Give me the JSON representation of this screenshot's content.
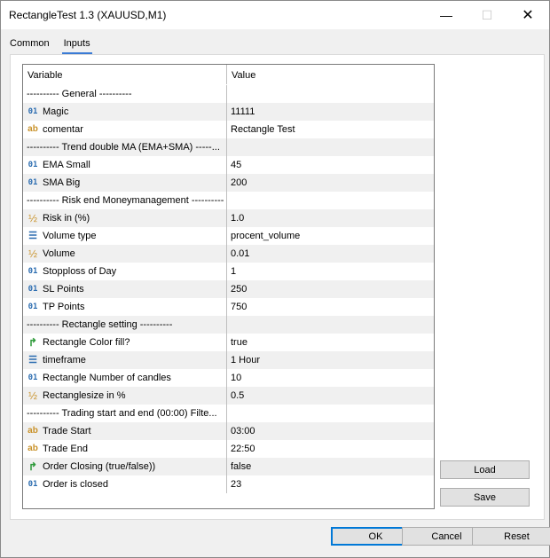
{
  "window": {
    "title": "RectangleTest 1.3 (XAUUSD,M1)",
    "min_glyph": "—",
    "max_glyph": "☐",
    "close_glyph": "✕"
  },
  "tabs": [
    {
      "label": "Common"
    },
    {
      "label": "Inputs",
      "active": true
    }
  ],
  "grid": {
    "headers": {
      "variable": "Variable",
      "value": "Value"
    },
    "rows": [
      {
        "type": "sep",
        "label": "---------- General ----------",
        "value": ""
      },
      {
        "type": "int",
        "label": "Magic",
        "value": "11111"
      },
      {
        "type": "str",
        "label": "comentar",
        "value": "Rectangle Test"
      },
      {
        "type": "sep",
        "label": "---------- Trend double MA (EMA+SMA) -----...",
        "value": ""
      },
      {
        "type": "int",
        "label": "EMA Small",
        "value": "45"
      },
      {
        "type": "int",
        "label": "SMA Big",
        "value": "200"
      },
      {
        "type": "sep",
        "label": "---------- Risk end Moneymanagement ----------",
        "value": ""
      },
      {
        "type": "dbl",
        "label": "Risk in (%)",
        "value": "1.0"
      },
      {
        "type": "enum",
        "label": "Volume type",
        "value": "procent_volume"
      },
      {
        "type": "dbl",
        "label": "Volume",
        "value": "0.01"
      },
      {
        "type": "int",
        "label": "Stopploss of Day",
        "value": "1"
      },
      {
        "type": "int",
        "label": "SL Points",
        "value": "250"
      },
      {
        "type": "int",
        "label": "TP Points",
        "value": "750"
      },
      {
        "type": "sep",
        "label": "---------- Rectangle setting ----------",
        "value": ""
      },
      {
        "type": "bool",
        "label": "Rectangle Color fill?",
        "value": "true"
      },
      {
        "type": "enum",
        "label": "timeframe",
        "value": "1 Hour"
      },
      {
        "type": "int",
        "label": "Rectangle Number of candles",
        "value": "10"
      },
      {
        "type": "dbl",
        "label": "Rectanglesize in %",
        "value": "0.5"
      },
      {
        "type": "sep",
        "label": "---------- Trading start and end (00:00) Filte...",
        "value": ""
      },
      {
        "type": "str",
        "label": "Trade Start",
        "value": "03:00"
      },
      {
        "type": "str",
        "label": "Trade End",
        "value": "22:50"
      },
      {
        "type": "bool",
        "label": "Order Closing (true/false))",
        "value": "false"
      },
      {
        "type": "int",
        "label": "Order is closed",
        "value": "23"
      }
    ]
  },
  "icons": {
    "int": "01",
    "str": "ab",
    "dbl": "½",
    "enum": "☰",
    "bool": "↱"
  },
  "side_buttons": {
    "load": "Load",
    "save": "Save"
  },
  "footer_buttons": {
    "ok": "OK",
    "cancel": "Cancel",
    "reset": "Reset"
  }
}
